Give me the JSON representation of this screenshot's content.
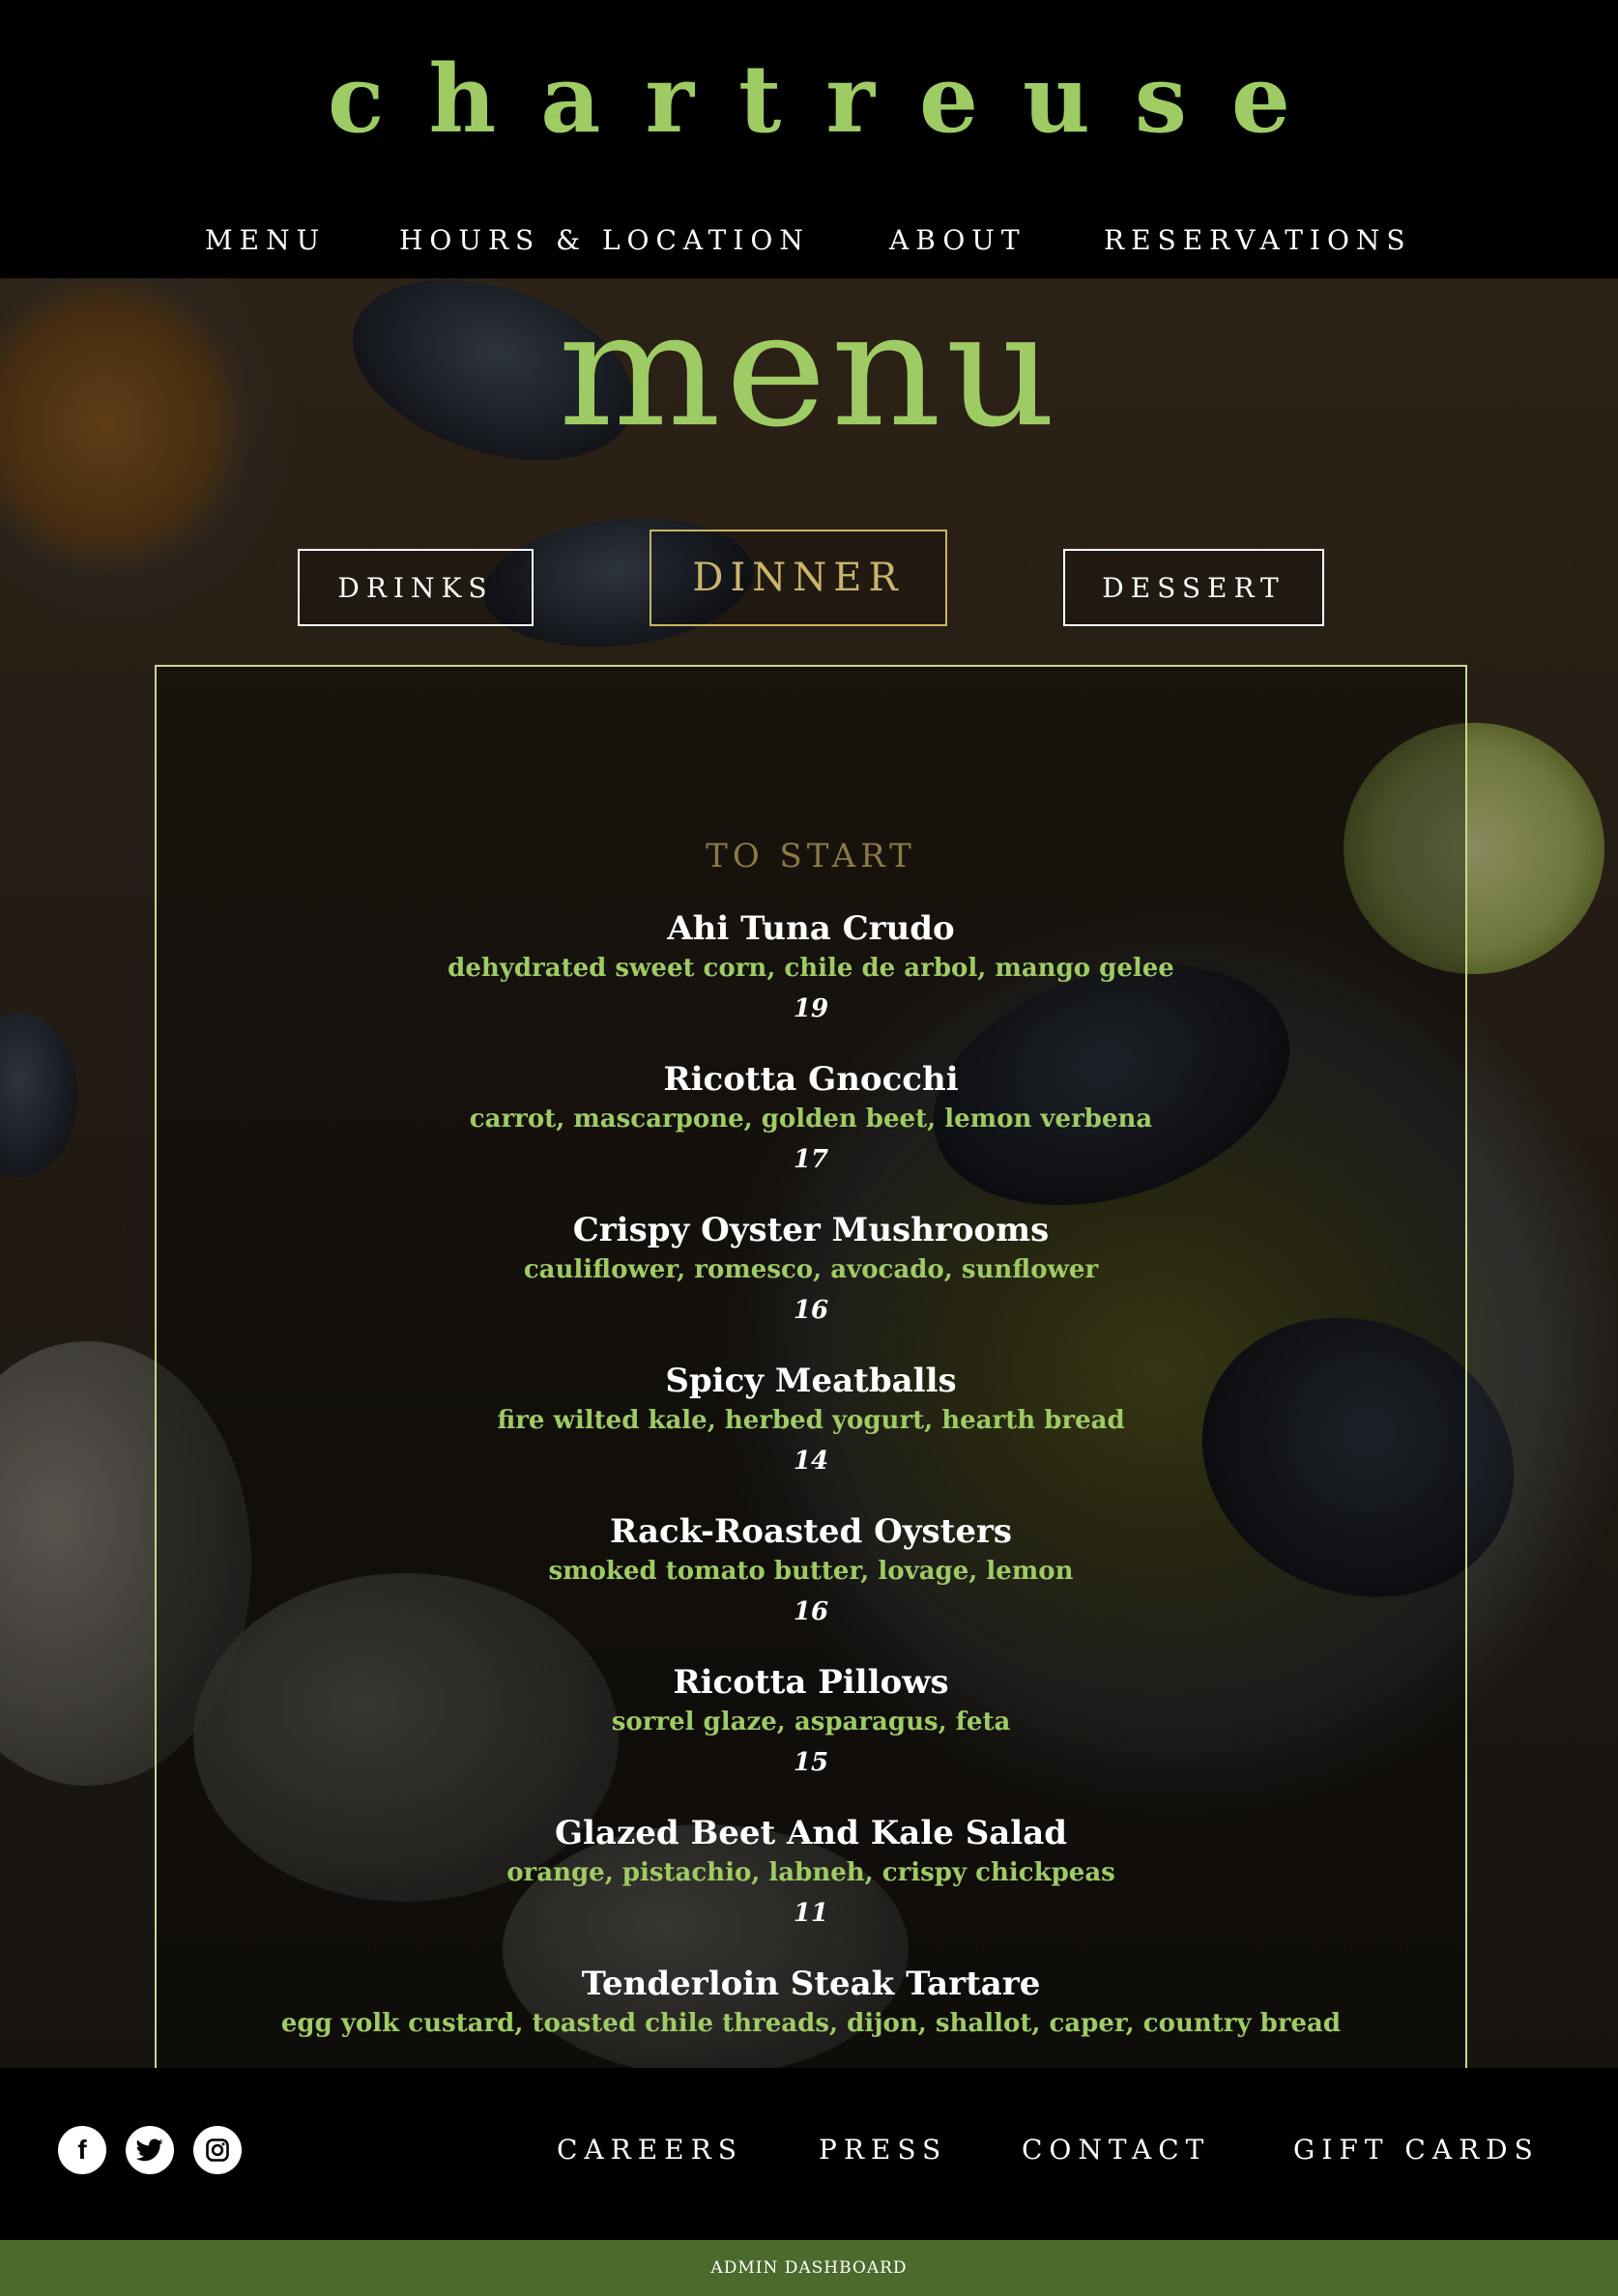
{
  "brand": {
    "name": "chartreuse"
  },
  "nav": {
    "menu": "MENU",
    "hours": "HOURS & LOCATION",
    "about": "ABOUT",
    "reservations": "RESERVATIONS"
  },
  "hero": {
    "heading": "menu"
  },
  "tabs": {
    "drinks": "DRINKS",
    "dinner": "DINNER",
    "dessert": "DESSERT",
    "active": "DINNER"
  },
  "section": {
    "title": "TO START",
    "dishes": [
      {
        "name": "Ahi Tuna Crudo",
        "desc": "dehydrated sweet corn, chile de arbol, mango gelee",
        "price": "19"
      },
      {
        "name": "Ricotta Gnocchi",
        "desc": "carrot, mascarpone, golden beet, lemon verbena",
        "price": "17"
      },
      {
        "name": "Crispy Oyster Mushrooms",
        "desc": "cauliflower, romesco, avocado, sunflower",
        "price": "16"
      },
      {
        "name": "Spicy Meatballs",
        "desc": "fire wilted kale, herbed yogurt, hearth bread",
        "price": "14"
      },
      {
        "name": "Rack-Roasted Oysters",
        "desc": "smoked tomato butter, lovage, lemon",
        "price": "16"
      },
      {
        "name": "Ricotta Pillows",
        "desc": "sorrel glaze, asparagus, feta",
        "price": "15"
      },
      {
        "name": "Glazed Beet And Kale Salad",
        "desc": "orange, pistachio, labneh, crispy chickpeas",
        "price": "11"
      },
      {
        "name": "Tenderloin Steak Tartare",
        "desc": "egg yolk custard, toasted chile threads, dijon, shallot, caper, country bread",
        "price": ""
      }
    ]
  },
  "footer": {
    "social": {
      "facebook": "f",
      "twitter": "twitter-icon",
      "instagram": "instagram-icon"
    },
    "careers": "CAREERS",
    "press": "PRESS",
    "contact": "CONTACT",
    "gift_cards": "GIFT CARDS"
  },
  "admin": {
    "label": "ADMIN DASHBOARD"
  },
  "colors": {
    "accent": "#9ecb64",
    "panel_border": "#c8d98a",
    "active_tab": "#c9b560",
    "admin_bar": "#4b6b2d"
  }
}
